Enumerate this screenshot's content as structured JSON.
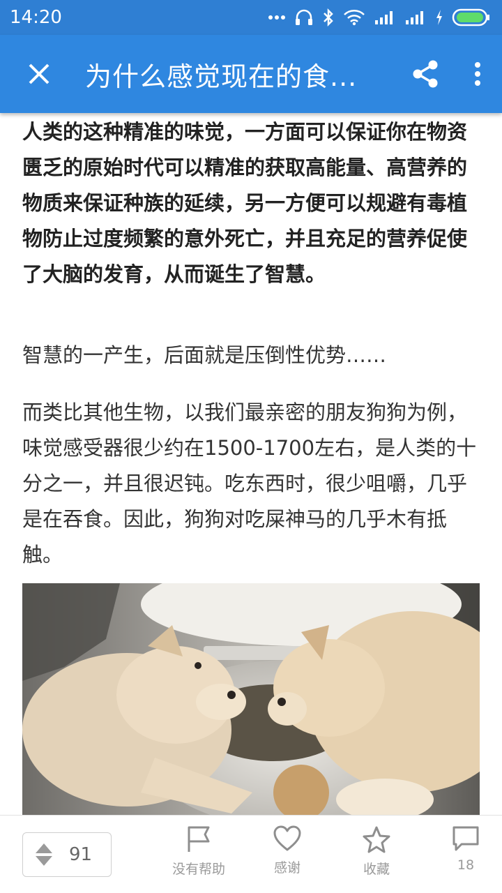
{
  "status_bar": {
    "time": "14:20",
    "icons": [
      "more-dots-icon",
      "headset-icon",
      "bluetooth-icon",
      "wifi-icon",
      "signal-icon",
      "signal-icon",
      "charging-icon",
      "battery-icon"
    ]
  },
  "app_bar": {
    "title": "为什么感觉现在的食...",
    "close_icon": "close-icon",
    "share_icon": "share-icon",
    "more_icon": "more-vert-icon",
    "color": "#2f87e0"
  },
  "article": {
    "para1": "人类的这种精准的味觉，一方面可以保证你在物资匮乏的原始时代可以精准的获取高能量、高营养的物质来保证种族的延续，另一方便可以规避有毒植物防止过度频繁的意外死亡，并且充足的营养促使了大脑的发育，从而诞生了智慧。",
    "para2": "智慧的一产生，后面就是压倒性优势……",
    "para3": "而类比其他生物，以我们最亲密的朋友狗狗为例，味觉感受器很少约在1500-1700左右，是人类的十分之一，并且很迟钝。吃东西时，很少咀嚼，几乎是在吞食。因此，狗狗对吃屎神马的几乎木有抵触。"
  },
  "bottom_bar": {
    "vote_count": "91",
    "no_help": "没有帮助",
    "thanks": "感谢",
    "favorite": "收藏",
    "comment_count": "18"
  }
}
